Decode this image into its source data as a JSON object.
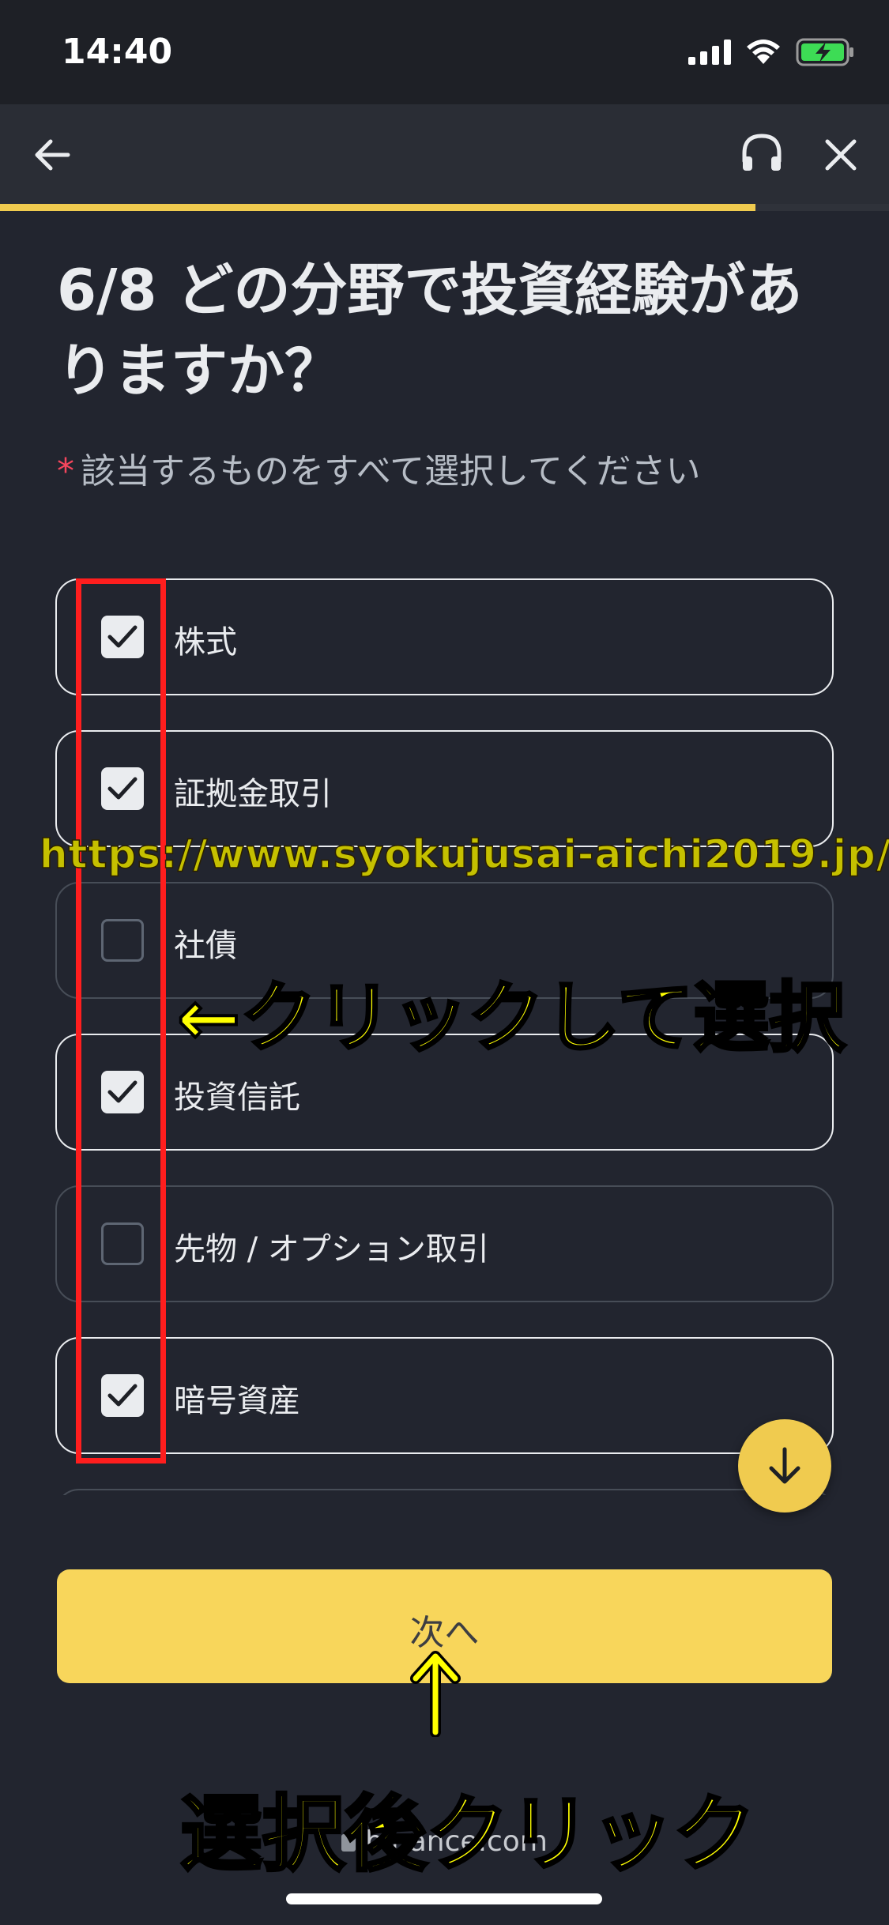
{
  "status_bar": {
    "time": "14:40"
  },
  "progress": {
    "step": 6,
    "total": 8,
    "fraction": 0.85
  },
  "question": {
    "title": "6/8 どの分野で投資経験がありますか？",
    "required_marker": "*",
    "instruction": "該当するものをすべて選択してください"
  },
  "options": [
    {
      "label": "株式",
      "checked": true
    },
    {
      "label": "証拠金取引",
      "checked": true
    },
    {
      "label": "社債",
      "checked": false
    },
    {
      "label": "投資信託",
      "checked": true
    },
    {
      "label": "先物 / オプション取引",
      "checked": false
    },
    {
      "label": "暗号資産",
      "checked": true
    }
  ],
  "next_button": {
    "label": "次へ"
  },
  "url": "binance.com",
  "overlays": {
    "watermark": "https://www.syokujusai-aichi2019.jp/",
    "click_note": "←クリックして選択",
    "after_note": "選択後クリック"
  },
  "colors": {
    "accent": "#f0cb4f",
    "background": "#22252f",
    "highlight": "#ff1e1e",
    "annotation": "#ffff00"
  }
}
